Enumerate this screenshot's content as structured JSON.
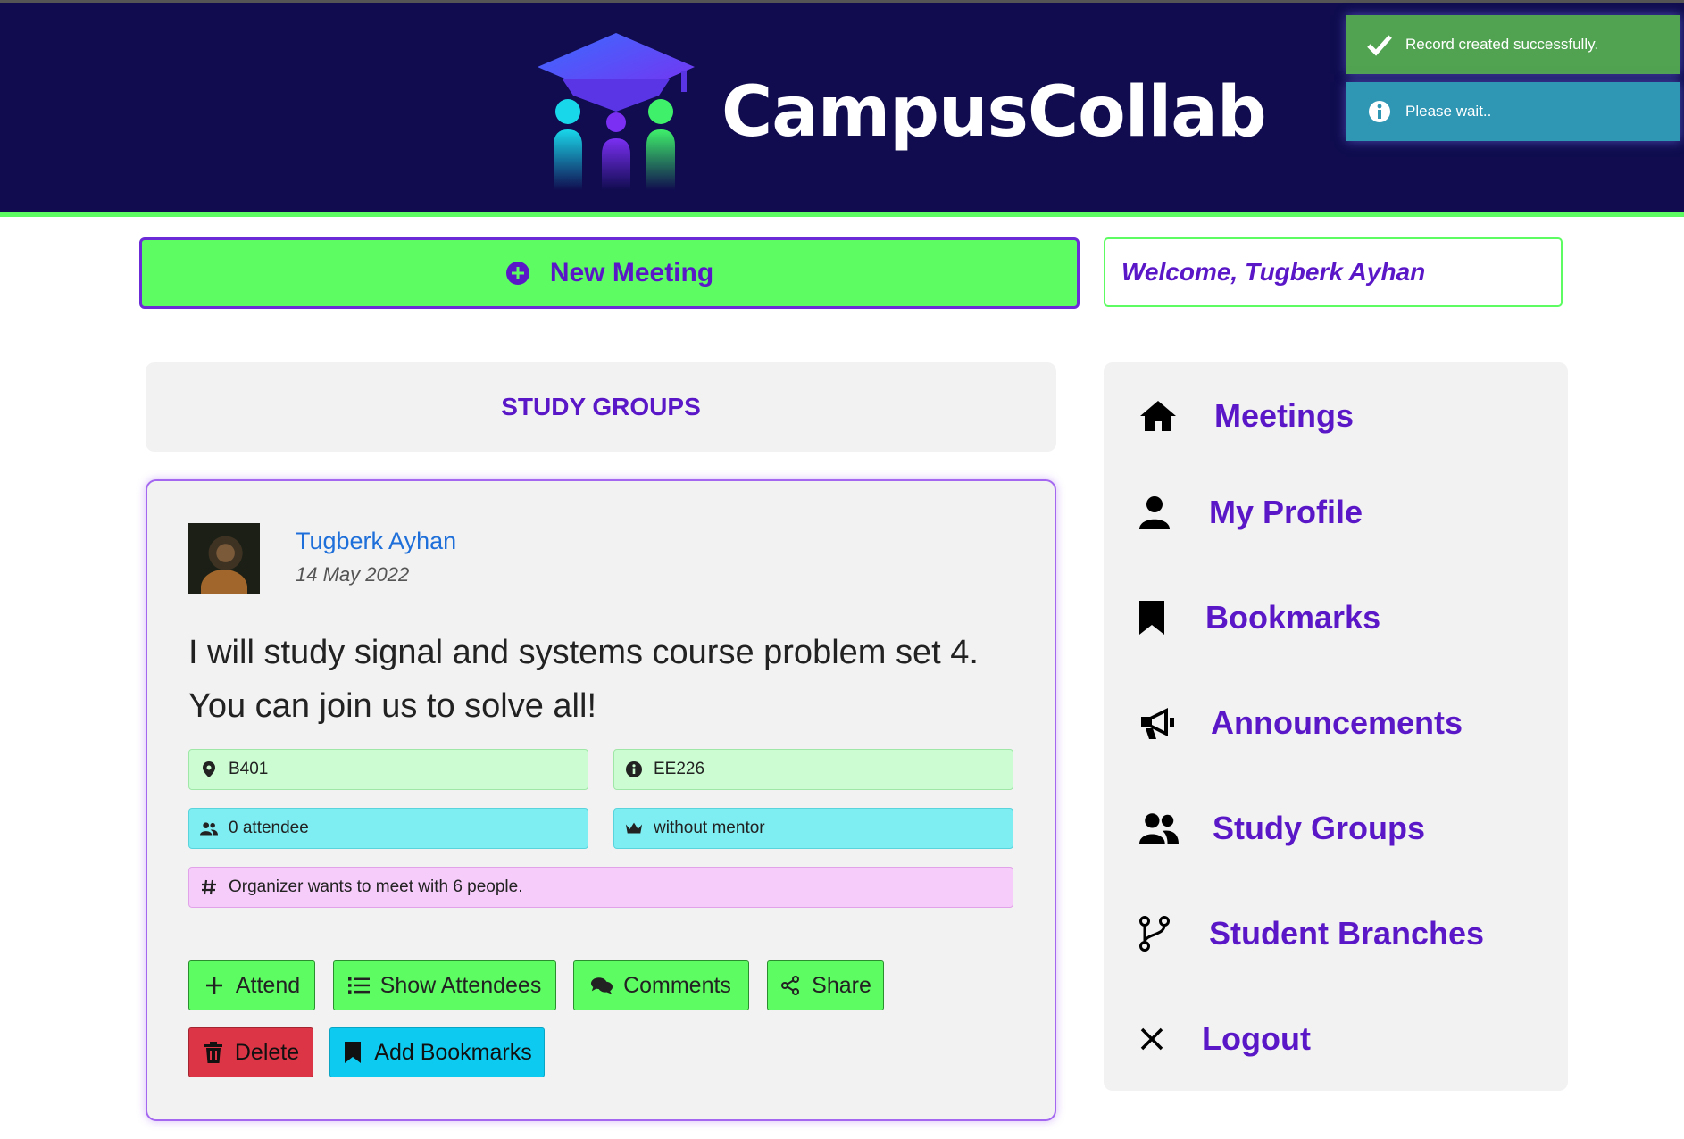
{
  "header": {
    "brand": "CampusCollab",
    "logo_icon": "graduation-cap-people-logo"
  },
  "toasts": [
    {
      "text": "Record created successfully.",
      "icon": "check-icon",
      "color": "#51a351"
    },
    {
      "text": "Please wait..",
      "icon": "info-icon",
      "color": "#2f96b4"
    }
  ],
  "top": {
    "new_meeting_label": "New Meeting",
    "welcome_text": "Welcome, Tugberk Ayhan"
  },
  "section_title": "STUDY GROUPS",
  "post": {
    "author": "Tugberk Ayhan",
    "date": "14 May 2022",
    "text_line1": "I will study signal and systems course problem set 4.",
    "text_line2": "You can join us to solve all!",
    "location": "B401",
    "course": "EE226",
    "attendees": "0 attendee",
    "mentor": "without mentor",
    "size_note": "Organizer wants to meet with 6 people.",
    "buttons": {
      "attend": "Attend",
      "show_attendees": "Show Attendees",
      "comments": "Comments",
      "share": "Share",
      "delete": "Delete",
      "add_bookmarks": "Add Bookmarks"
    }
  },
  "sidebar": {
    "items": [
      {
        "label": "Meetings",
        "icon": "home-icon"
      },
      {
        "label": "My Profile",
        "icon": "user-icon"
      },
      {
        "label": "Bookmarks",
        "icon": "bookmark-icon"
      },
      {
        "label": "Announcements",
        "icon": "megaphone-icon"
      },
      {
        "label": "Study Groups",
        "icon": "users-icon"
      },
      {
        "label": "Student Branches",
        "icon": "branch-icon"
      },
      {
        "label": "Logout",
        "icon": "close-icon"
      }
    ]
  },
  "colors": {
    "header_bg": "#100c4f",
    "accent_green": "#5dfc62",
    "accent_purple": "#5a17c7",
    "link_blue": "#1e6fd9"
  }
}
